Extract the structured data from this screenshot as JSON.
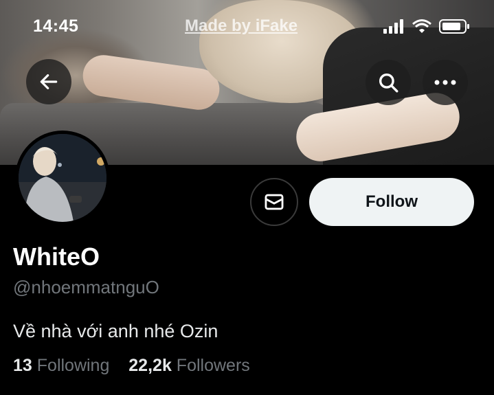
{
  "status_bar": {
    "time": "14:45",
    "watermark": "Made by iFake"
  },
  "banner": {
    "back_icon": "arrow-left-icon",
    "search_icon": "search-icon",
    "more_icon": "more-horizontal-icon"
  },
  "profile": {
    "display_name": "WhiteO",
    "handle": "@nhoemmatnguO",
    "bio": "Về nhà với anh nhé Ozin",
    "following_count": "13",
    "following_label": "Following",
    "followers_count": "22,2k",
    "followers_label": "Followers"
  },
  "actions": {
    "follow_label": "Follow",
    "message_icon": "mail-icon"
  },
  "colors": {
    "background": "#000000",
    "follow_button_bg": "#eff3f4",
    "secondary_text": "#71767b"
  }
}
